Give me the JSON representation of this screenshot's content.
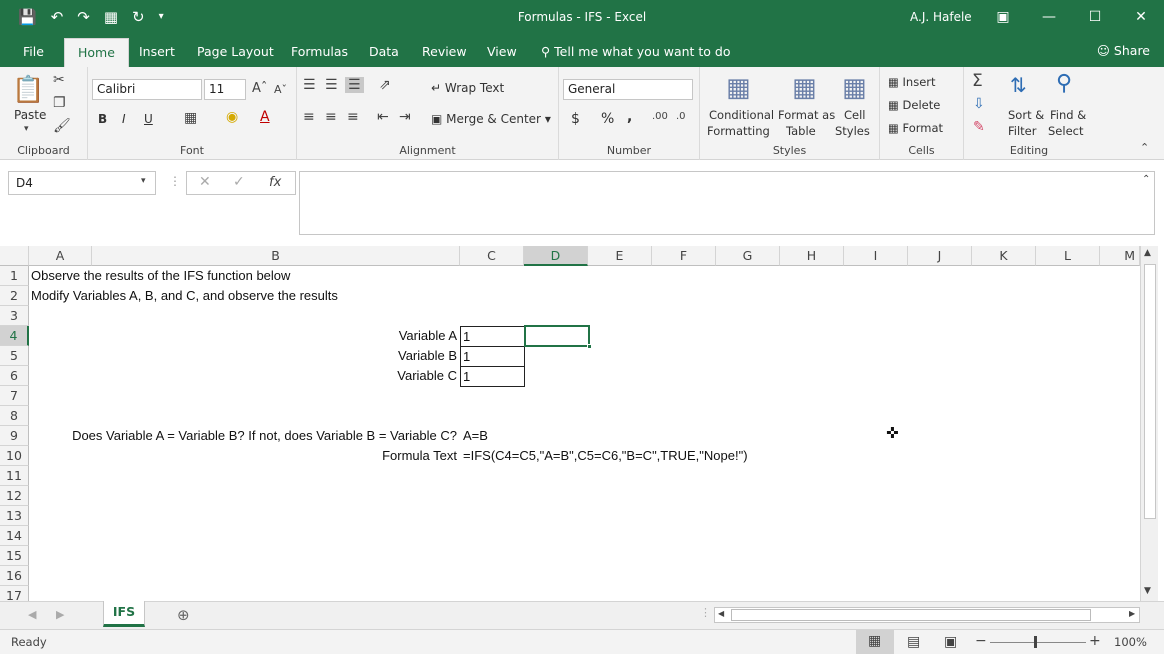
{
  "window": {
    "title": "Formulas - IFS  -  Excel",
    "user": "A.J. Hafele"
  },
  "ribbon_tabs": [
    "File",
    "Home",
    "Insert",
    "Page Layout",
    "Formulas",
    "Data",
    "Review",
    "View"
  ],
  "tell_me": "Tell me what you want to do",
  "share": "Share",
  "clipboard": {
    "paste": "Paste",
    "label": "Clipboard"
  },
  "font": {
    "name": "Calibri",
    "size": "11",
    "label": "Font",
    "bold": "B",
    "italic": "I",
    "underline": "U"
  },
  "alignment": {
    "wrap": "Wrap Text",
    "merge": "Merge & Center",
    "label": "Alignment"
  },
  "number": {
    "format": "General",
    "label": "Number",
    "currency": "$",
    "percent": "%",
    "comma": ","
  },
  "styles": {
    "cond1": "Conditional",
    "cond2": "Formatting",
    "fmt1": "Format as",
    "fmt2": "Table",
    "cell1": "Cell",
    "cell2": "Styles",
    "label": "Styles"
  },
  "cells": {
    "insert": "Insert",
    "delete": "Delete",
    "format": "Format",
    "label": "Cells"
  },
  "editing": {
    "sort1": "Sort &",
    "sort2": "Filter",
    "find1": "Find &",
    "find2": "Select",
    "label": "Editing"
  },
  "name_box": "D4",
  "fx": "fx",
  "columns": [
    "A",
    "B",
    "C",
    "D",
    "E",
    "F",
    "G",
    "H",
    "I",
    "J",
    "K",
    "L",
    "M"
  ],
  "rows": [
    "1",
    "2",
    "3",
    "4",
    "5",
    "6",
    "7",
    "8",
    "9",
    "10",
    "11",
    "12",
    "13",
    "14",
    "15",
    "16",
    "17"
  ],
  "cells_text": {
    "A1": "Observe the results of the IFS function below",
    "A2": "Modify Variables A, B, and C, and observe the results",
    "B4": "Variable A",
    "C4": "1",
    "B5": "Variable B",
    "C5": "1",
    "B6": "Variable C",
    "C6": "1",
    "B9": "Does Variable A = Variable B?  If not, does Variable B = Variable C?",
    "C9": "A=B",
    "B10": "Formula Text",
    "C10": "=IFS(C4=C5,\"A=B\",C5=C6,\"B=C\",TRUE,\"Nope!\")"
  },
  "sheet_tab": "IFS",
  "status": {
    "ready": "Ready",
    "zoom": "100%"
  },
  "colors": {
    "brand": "#217346"
  }
}
